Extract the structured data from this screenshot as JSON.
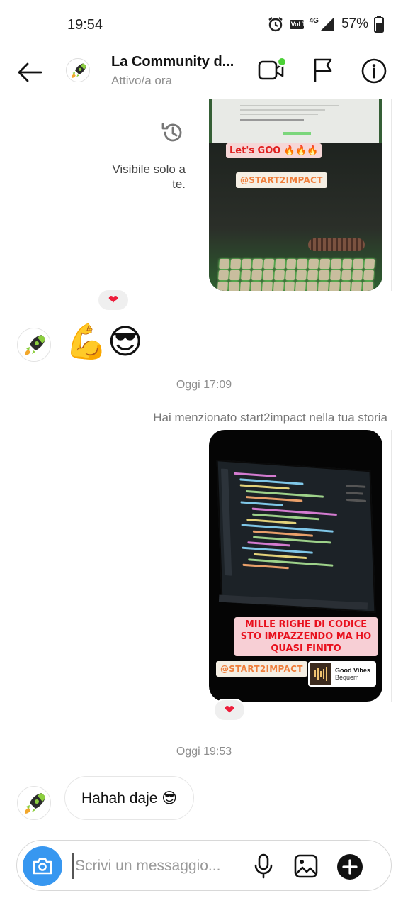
{
  "status_bar": {
    "time": "19:54",
    "network": "4G",
    "battery": "57%",
    "volte": "VoLTE"
  },
  "header": {
    "title": "La Community d...",
    "subtitle": "Attivo/a ora",
    "online_color": "#4cd137"
  },
  "messages": {
    "story_1": {
      "sticker_lets_go": "Let's GOO 🔥🔥🔥",
      "sticker_handle": "@START2IMPACT",
      "visibility_note": "Visibile solo a te.",
      "reaction": "❤"
    },
    "reply_emoji": "💪😎",
    "timestamp_1": "Oggi 17:09",
    "mention_note": "Hai menzionato start2impact nella tua storia",
    "story_2": {
      "sticker_caption": "MILLE RIGHE DI CODICE STO IMPAZZENDO MA HO QUASI FINITO",
      "sticker_handle": "@START2IMPACT",
      "music_title": "Good Vibes",
      "music_artist": "Bequem",
      "reaction": "❤"
    },
    "timestamp_2": "Oggi 19:53",
    "last_message": "Hahah daje 😎"
  },
  "composer": {
    "placeholder": "Scrivi un messaggio...",
    "accent_color": "#3797f0"
  },
  "icons": {
    "back": "arrow-left-icon",
    "video": "video-call-icon",
    "flag": "flag-icon",
    "info": "info-icon",
    "camera": "camera-icon",
    "mic": "microphone-icon",
    "gallery": "gallery-icon",
    "plus": "plus-circle-icon",
    "history": "history-icon"
  }
}
